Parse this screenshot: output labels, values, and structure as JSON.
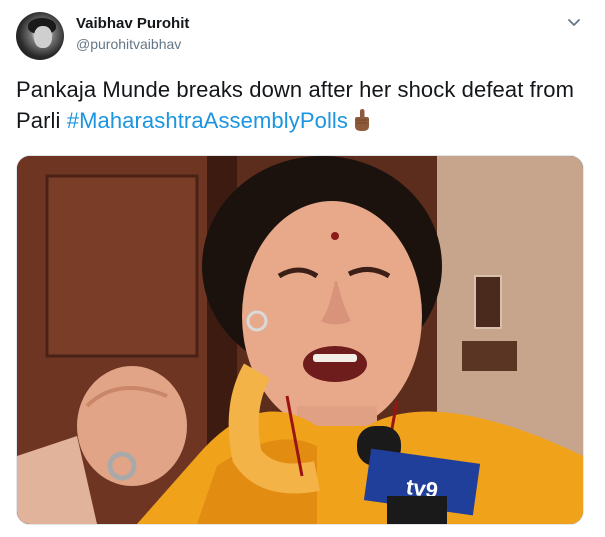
{
  "user": {
    "display_name": "Vaibhav Purohit",
    "handle": "@purohitvaibhav",
    "avatar_icon": "profile-photo"
  },
  "tweet": {
    "text_before": "Pankaja Munde breaks down after her shock defeat from Parli ",
    "hashtag": "#MaharashtraAssemblyPolls",
    "emoji_icon": "middle-finger-emoji"
  },
  "menu": {
    "icon": "chevron-down-icon"
  },
  "media": {
    "type": "photo",
    "microphone_logo": "tv9",
    "colors": {
      "saree": "#f0a21a",
      "background": "#5a2a1c",
      "hashtag": "#1b95e0"
    }
  }
}
